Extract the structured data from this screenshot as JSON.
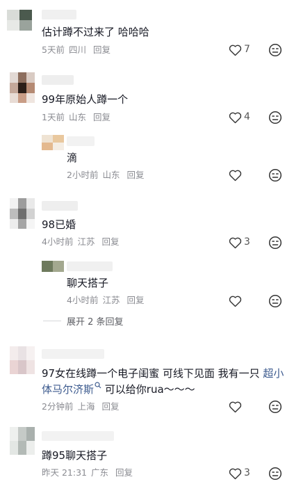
{
  "comments": [
    {
      "text": "估计蹲不过来了 哈哈哈",
      "time": "5天前",
      "location": "四川",
      "reply": "回复",
      "likes": "7"
    },
    {
      "text": "99年原始人蹲一个",
      "time": "1天前",
      "location": "山东",
      "reply": "回复",
      "likes": "4",
      "replies": [
        {
          "text": "滴",
          "time": "2小时前",
          "location": "山东",
          "reply": "回复",
          "likes": ""
        }
      ]
    },
    {
      "text": "98已婚",
      "time": "4小时前",
      "location": "江苏",
      "reply": "回复",
      "likes": "3",
      "replies": [
        {
          "text": "聊天搭子",
          "time": "4小时前",
          "location": "江苏",
          "reply": "回复",
          "likes": ""
        }
      ],
      "expand_label": "展开 2 条回复"
    },
    {
      "text_line1": "97女在线蹲一个电子闺蜜 可线下见面 我有一只 ",
      "link_part1": "超小",
      "link_part2": "体马尔济斯",
      "text_line2_rest": " 可以给你rua～～～",
      "time": "2分钟前",
      "location": "上海",
      "reply": "回复",
      "likes": ""
    },
    {
      "text": "蹲95聊天搭子",
      "time": "昨天 21:31",
      "location": "广东",
      "reply": "回复",
      "likes": "3"
    }
  ]
}
